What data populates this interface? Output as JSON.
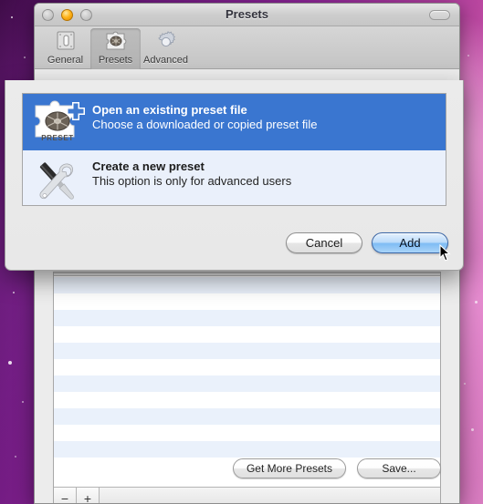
{
  "desktop": {
    "wallpaper_name": "purple-galaxy-wallpaper"
  },
  "window": {
    "title": "Presets",
    "traffic_lights": [
      {
        "name": "close-button",
        "state": "disabled"
      },
      {
        "name": "minimize-button",
        "state": "active"
      },
      {
        "name": "zoom-button",
        "state": "disabled"
      }
    ],
    "toolbar_toggle": "toolbar-toggle-button",
    "toolbar": {
      "items": [
        {
          "label": "General",
          "icon": "general-switch-icon",
          "selected": false
        },
        {
          "label": "Presets",
          "icon": "presets-puzzle-icon",
          "selected": true
        },
        {
          "label": "Advanced",
          "icon": "gear-icon",
          "selected": false
        }
      ]
    },
    "table": {
      "row_count": 12,
      "rows": [
        "",
        "",
        "",
        "",
        "",
        "",
        "",
        "",
        "",
        "",
        "",
        ""
      ],
      "segmented_controls": [
        {
          "label": "−",
          "name": "remove-preset-button"
        },
        {
          "label": "+",
          "name": "add-preset-button"
        }
      ]
    },
    "footer_buttons": [
      {
        "label": "Get More Presets",
        "name": "get-more-presets-button"
      },
      {
        "label": "Save...",
        "name": "save-button"
      }
    ]
  },
  "sheet": {
    "options": [
      {
        "title": "Open an existing preset file",
        "subtitle": "Choose a downloaded or copied preset file",
        "icon": "preset-file-plus-icon",
        "selected": true
      },
      {
        "title": "Create a new preset",
        "subtitle": "This option is only for advanced users",
        "icon": "screwdriver-wrench-icon",
        "selected": false
      }
    ],
    "buttons": [
      {
        "label": "Cancel",
        "name": "cancel-button",
        "default": false
      },
      {
        "label": "Add",
        "name": "add-button",
        "default": true
      }
    ]
  },
  "colors": {
    "selection_blue": "#3a76d0",
    "stripe_blue": "#eaf1fb",
    "window_chrome": "#ececec",
    "accent_amber": "#ffb319"
  }
}
